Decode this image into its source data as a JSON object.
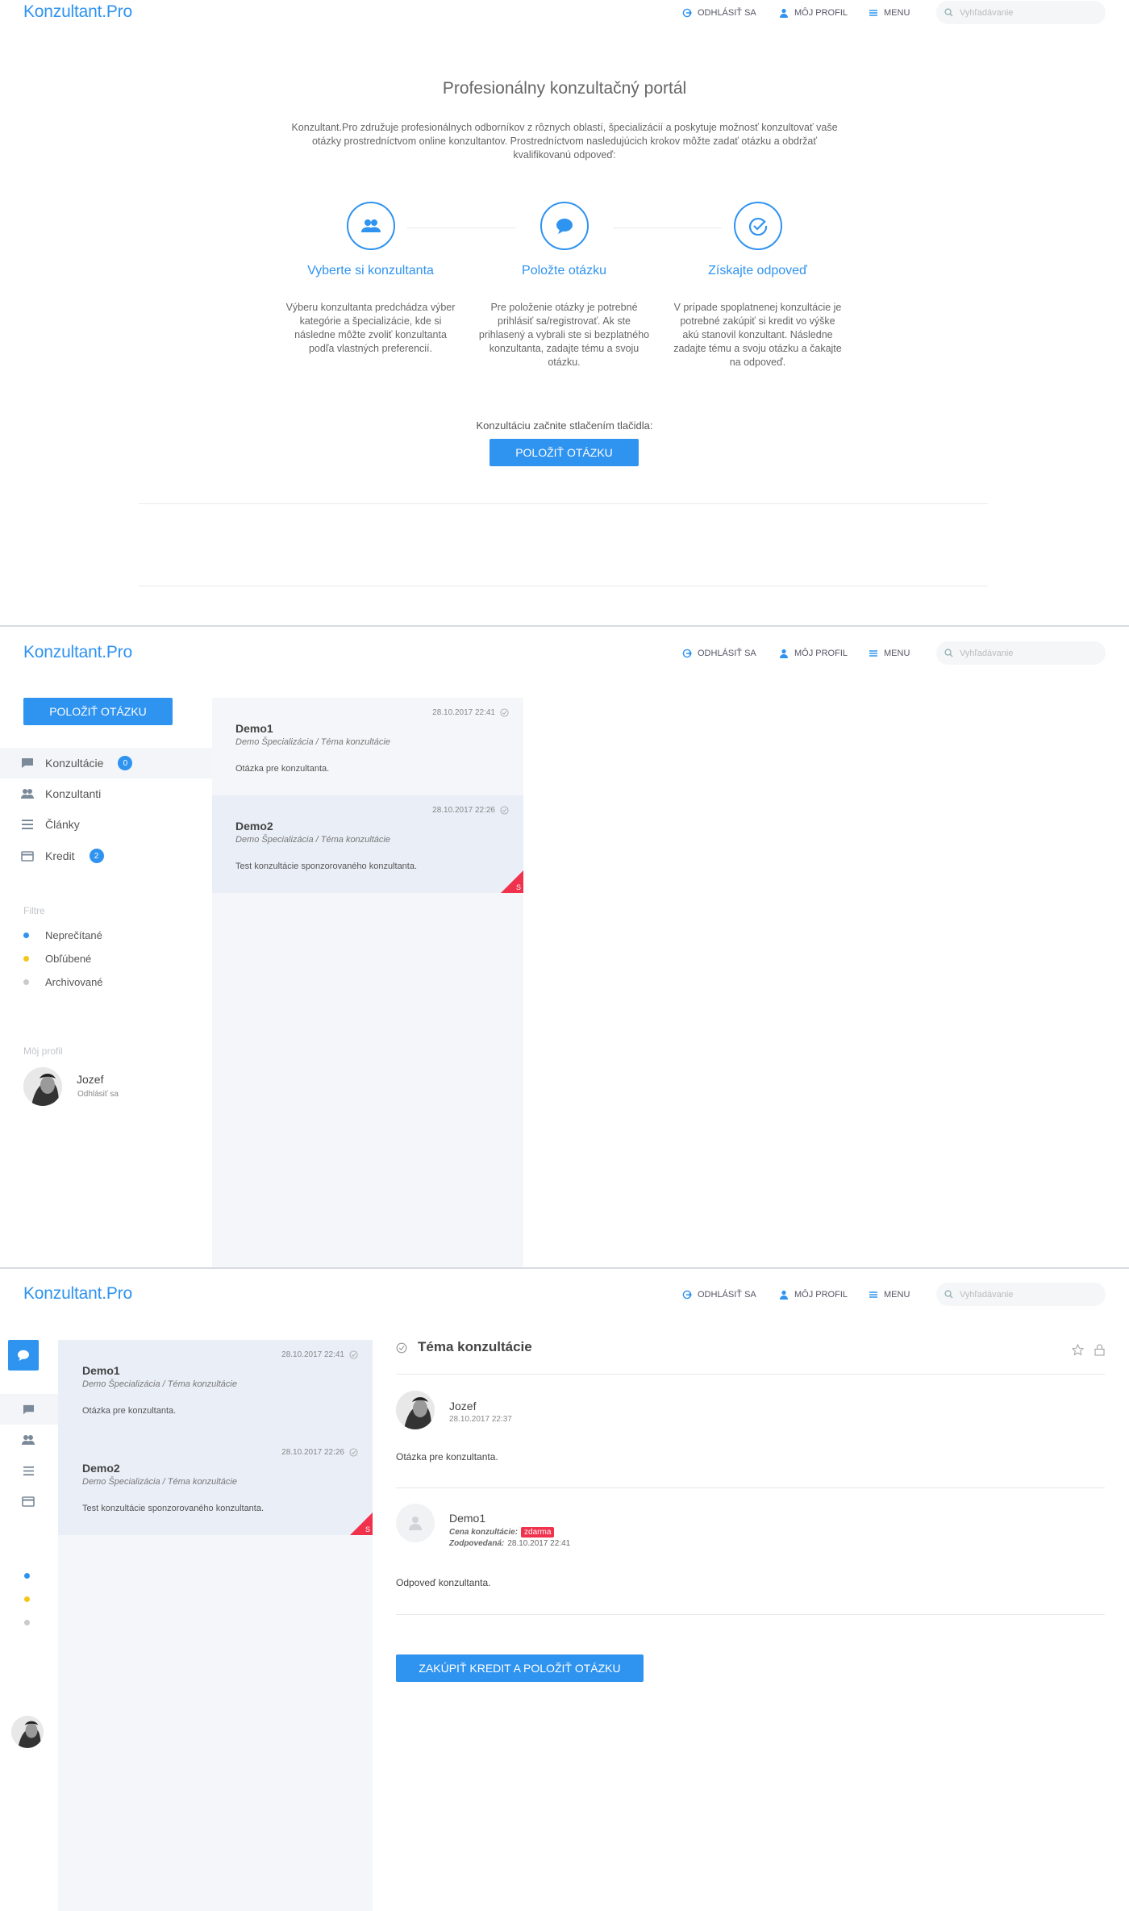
{
  "header": {
    "logo": "Konzultant.Pro",
    "logout_label": "ODHLÁSIŤ SA",
    "profile_label": "MÔJ PROFIL",
    "menu_label": "MENU",
    "search_placeholder": "Vyhľadávanie"
  },
  "landing": {
    "title": "Profesionálny konzultačný portál",
    "intro": "Konzultant.Pro združuje profesionálnych odborníkov z rôznych oblastí, špecializácií a poskytuje možnosť konzultovať vaše otázky prostredníctvom online konzultantov. Prostredníctvom nasledujúcich krokov môžte zadať otázku a obdržať kvalifikovanú odpoveď:",
    "steps": [
      {
        "icon": "users-icon",
        "title": "Vyberte si konzultanta",
        "desc": "Výberu konzultanta predchádza výber kategórie a špecializácie, kde si následne môžte zvoliť konzultanta podľa vlastných preferencií."
      },
      {
        "icon": "speech-bubble-icon",
        "title": "Položte otázku",
        "desc": "Pre položenie otázky je potrebné prihlásiť sa/registrovať. Ak ste prihlasený a vybrali ste si bezplatného konzultanta, zadajte tému a svoju otázku."
      },
      {
        "icon": "check-circle-icon",
        "title": "Získajte odpoveď",
        "desc": "V prípade spoplatnenej konzultácie je potrebné zakúpiť si kredit vo výške akú stanovil konzultant. Následne zadajte tému a svoju otázku a čakajte na odpoveď."
      }
    ],
    "cta_text": "Konzultáciu začnite stlačením tlačidla:",
    "cta_button": "POLOŽIŤ OTÁZKU"
  },
  "sidebar": {
    "ask_button": "POLOŽIŤ OTÁZKU",
    "items": [
      {
        "label": "Konzultácie",
        "icon": "chat-icon",
        "badge": "0"
      },
      {
        "label": "Konzultanti",
        "icon": "users-icon",
        "badge": ""
      },
      {
        "label": "Články",
        "icon": "list-icon",
        "badge": ""
      },
      {
        "label": "Kredit",
        "icon": "credit-card-icon",
        "badge": "2"
      }
    ],
    "filters_label": "Filtre",
    "filters": [
      {
        "label": "Neprečítané",
        "color": "#2f93f0"
      },
      {
        "label": "Obľúbené",
        "color": "#f5c518"
      },
      {
        "label": "Archivované",
        "color": "#c8cace"
      }
    ],
    "profile_label": "Môj profil",
    "user_name": "Jozef",
    "user_logout": "Odhlásiť sa"
  },
  "consultations": [
    {
      "title": "Demo1",
      "subtitle": "Demo Špecializácia / Téma konzultácie",
      "date": "28.10.2017 22:41",
      "body": "Otázka pre konzultanta.",
      "sponsored": false
    },
    {
      "title": "Demo2",
      "subtitle": "Demo Špecializácia / Téma konzultácie",
      "date": "28.10.2017 22:26",
      "body": "Test konzultácie sponzorovaného konzultanta.",
      "sponsored": true,
      "sponsored_mark": "S"
    }
  ],
  "detail": {
    "title": "Téma konzultácie",
    "question": {
      "author": "Jozef",
      "date": "28.10.2017 22:37",
      "text": "Otázka pre konzultanta."
    },
    "answer": {
      "author": "Demo1",
      "price_label": "Cena konzultácie:",
      "price_value": "zdarma",
      "answered_label": "Zodpovedaná:",
      "answered_value": "28.10.2017 22:41",
      "text": "Odpoveď konzultanta."
    },
    "buy_button": "ZAKÚPIŤ KREDIT A POLOŽIŤ OTÁZKU"
  }
}
